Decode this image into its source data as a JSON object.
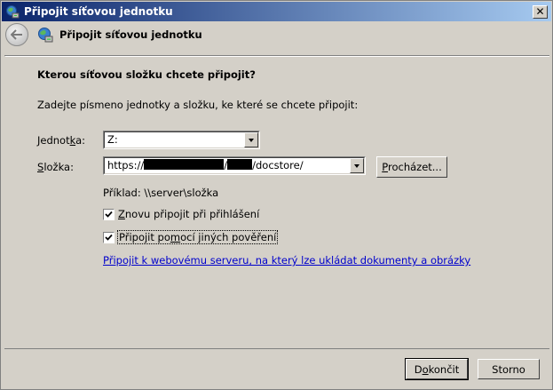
{
  "window": {
    "title": "Připojit síťovou jednotku",
    "close_label": "✕"
  },
  "header": {
    "title": "Připojit síťovou jednotku"
  },
  "main": {
    "heading": "Kterou síťovou složku chcete připojit?",
    "instruction": "Zadejte písmeno jednotky a složku, ke které se chcete připojit:",
    "drive": {
      "label_prefix": "Jednot",
      "label_accel": "k",
      "label_suffix": "a:",
      "value": "Z:"
    },
    "folder": {
      "label_accel": "S",
      "label_suffix": "ložka:",
      "value_prefix": "https://",
      "value_mid": "/",
      "value_suffix": "/docstore/"
    },
    "browse_button": {
      "accel": "P",
      "rest": "rocházet..."
    },
    "example": "Příklad: \\\\server\\složka",
    "reconnect": {
      "checked": true,
      "accel": "Z",
      "rest": "novu připojit při přihlášení"
    },
    "other_credentials": {
      "checked": true,
      "prefix": "Připojit po",
      "accel": "m",
      "rest": "ocí jiných pověření"
    },
    "link": "Připojit k webovému serveru, na který lze ukládat dokumenty a obrázky"
  },
  "footer": {
    "finish_prefix": "D",
    "finish_accel": "o",
    "finish_rest": "končit",
    "cancel": "Storno"
  },
  "colors": {
    "dialog_bg": "#d4d0c8",
    "titlebar_start": "#0a246a",
    "titlebar_end": "#a6caf0",
    "link": "#0000cc"
  }
}
